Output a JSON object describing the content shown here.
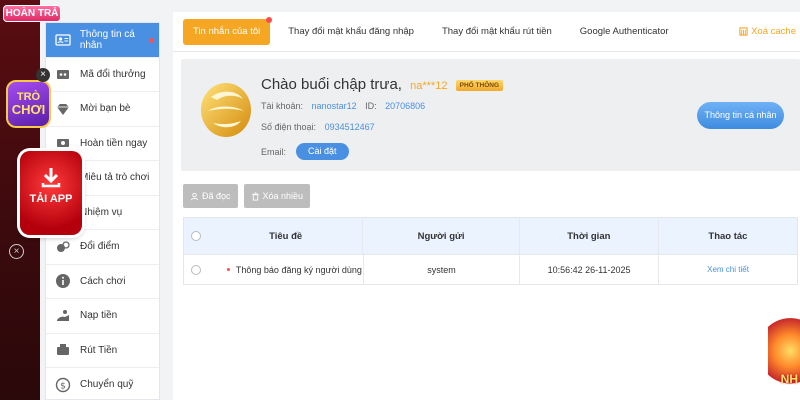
{
  "badge": {
    "hoan_tra": "HOÀN TRẢ"
  },
  "promo": {
    "close": "×",
    "game_line1": "TRÒ",
    "game_line2": "CHƠI",
    "tai_app": "TẢI APP",
    "side_close": "×"
  },
  "sidebar": {
    "items": [
      {
        "label": "Thông tin cá nhân",
        "icon": "user-card-icon",
        "active": true,
        "dot": true
      },
      {
        "label": "Mã đổi thưởng",
        "icon": "gift-code-icon"
      },
      {
        "label": "Mời bạn bè",
        "icon": "diamond-icon"
      },
      {
        "label": "Hoàn tiền ngay",
        "icon": "refund-icon"
      },
      {
        "label": "Miêu tả trò chơi",
        "icon": "description-icon"
      },
      {
        "label": "Nhiệm vụ",
        "icon": "mission-icon"
      },
      {
        "label": "Đổi điểm",
        "icon": "points-icon"
      },
      {
        "label": "Cách chơi",
        "icon": "info-icon"
      },
      {
        "label": "Nạp tiền",
        "icon": "deposit-icon"
      },
      {
        "label": "Rút Tiền",
        "icon": "withdraw-icon"
      },
      {
        "label": "Chuyển quỹ",
        "icon": "transfer-icon"
      }
    ]
  },
  "tabs": [
    {
      "label": "Tin nhắn của tôi",
      "active": true
    },
    {
      "label": "Thay đổi mật khẩu đăng nhập"
    },
    {
      "label": "Thay đổi mật khẩu rút tiền"
    },
    {
      "label": "Google Authenticator"
    }
  ],
  "clear_cache": "Xoá cache",
  "profile": {
    "greeting": "Chào buổi chập trưa,",
    "username": "na***12",
    "rank": "PHỔ THÔNG",
    "account_label": "Tài khoản:",
    "account_value": "nanostar12",
    "id_label": "ID:",
    "id_value": "20706806",
    "phone_label": "Số điện thoại:",
    "phone_value": "0934512467",
    "email_label": "Email:",
    "setup_button": "Cài đặt",
    "info_button": "Thông tin cá nhân"
  },
  "actions": {
    "read": "Đã đọc",
    "delete_many": "Xóa nhiều"
  },
  "table": {
    "headers": {
      "title": "Tiêu đề",
      "sender": "Người gửi",
      "time": "Thời gian",
      "action": "Thao tác"
    },
    "rows": [
      {
        "title": "Thông báo đăng ký người dùng",
        "sender": "system",
        "time": "10:56:42 26-11-2025",
        "action": "Xem chi tiết"
      }
    ]
  },
  "deco_right": {
    "text": "NH"
  },
  "colors": {
    "accent_blue": "#4a90e2",
    "accent_orange": "#f5a623",
    "alert_red": "#ff4d4f"
  }
}
